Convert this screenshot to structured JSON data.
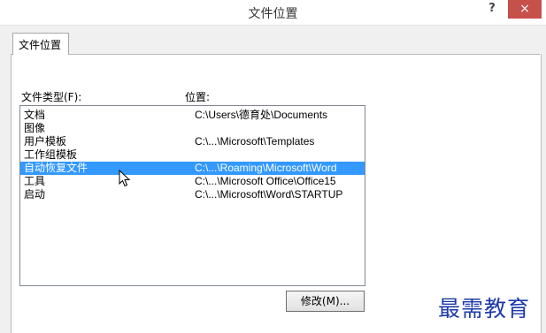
{
  "window": {
    "title": "文件位置",
    "help_label": "?",
    "close_label": "×"
  },
  "tabs": [
    {
      "label": "文件位置"
    }
  ],
  "labels": {
    "file_types": "文件类型(F):",
    "location": "位置:"
  },
  "list": {
    "items": [
      {
        "name": "文档",
        "path": "C:\\Users\\德育处\\Documents"
      },
      {
        "name": "图像",
        "path": ""
      },
      {
        "name": "用户模板",
        "path": "C:\\...\\Microsoft\\Templates"
      },
      {
        "name": "工作组模板",
        "path": ""
      },
      {
        "name": "自动恢复文件",
        "path": "C:\\...\\Roaming\\Microsoft\\Word",
        "selected": true
      },
      {
        "name": "工具",
        "path": "C:\\...\\Microsoft Office\\Office15"
      },
      {
        "name": "启动",
        "path": "C:\\...\\Microsoft\\Word\\STARTUP"
      }
    ]
  },
  "buttons": {
    "modify": "修改(M)..."
  },
  "watermark": "最需教育",
  "colors": {
    "selection": "#3399ff",
    "close": "#c7504b",
    "watermark": "#1d3aa8"
  }
}
